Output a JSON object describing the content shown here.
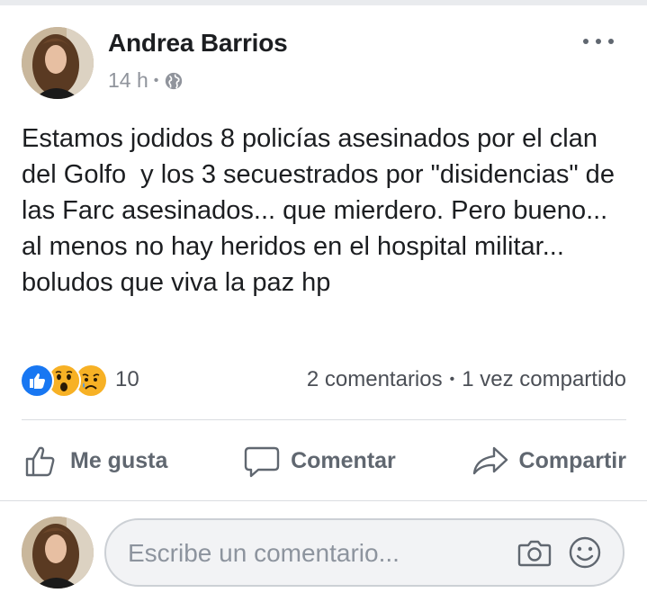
{
  "post": {
    "author": "Andrea Barrios",
    "time": "14 h",
    "separator": "•",
    "privacy_icon": "globe-icon",
    "text": "Estamos jodidos 8 policías asesinados por el clan del Golfo  y los 3 secuestrados por \"disidencias\" de las Farc asesinados... que mierdero. Pero bueno... al menos no hay heridos en el hospital militar... boludos que viva la paz hp"
  },
  "reactions": {
    "icons": [
      "like-icon",
      "wow-icon",
      "sad-icon"
    ],
    "count": "10",
    "comments": "2 comentarios",
    "separator": "•",
    "shares": "1 vez compartido"
  },
  "actions": {
    "like_label": "Me gusta",
    "comment_label": "Comentar",
    "share_label": "Compartir"
  },
  "comment_box": {
    "placeholder": "Escribe un comentario..."
  },
  "colors": {
    "text": "#1c1e21",
    "secondary": "#90949c",
    "action": "#606770",
    "like_blue": "#1877f2",
    "reaction_yellow": "#f7b125",
    "divider": "#dadde1"
  }
}
